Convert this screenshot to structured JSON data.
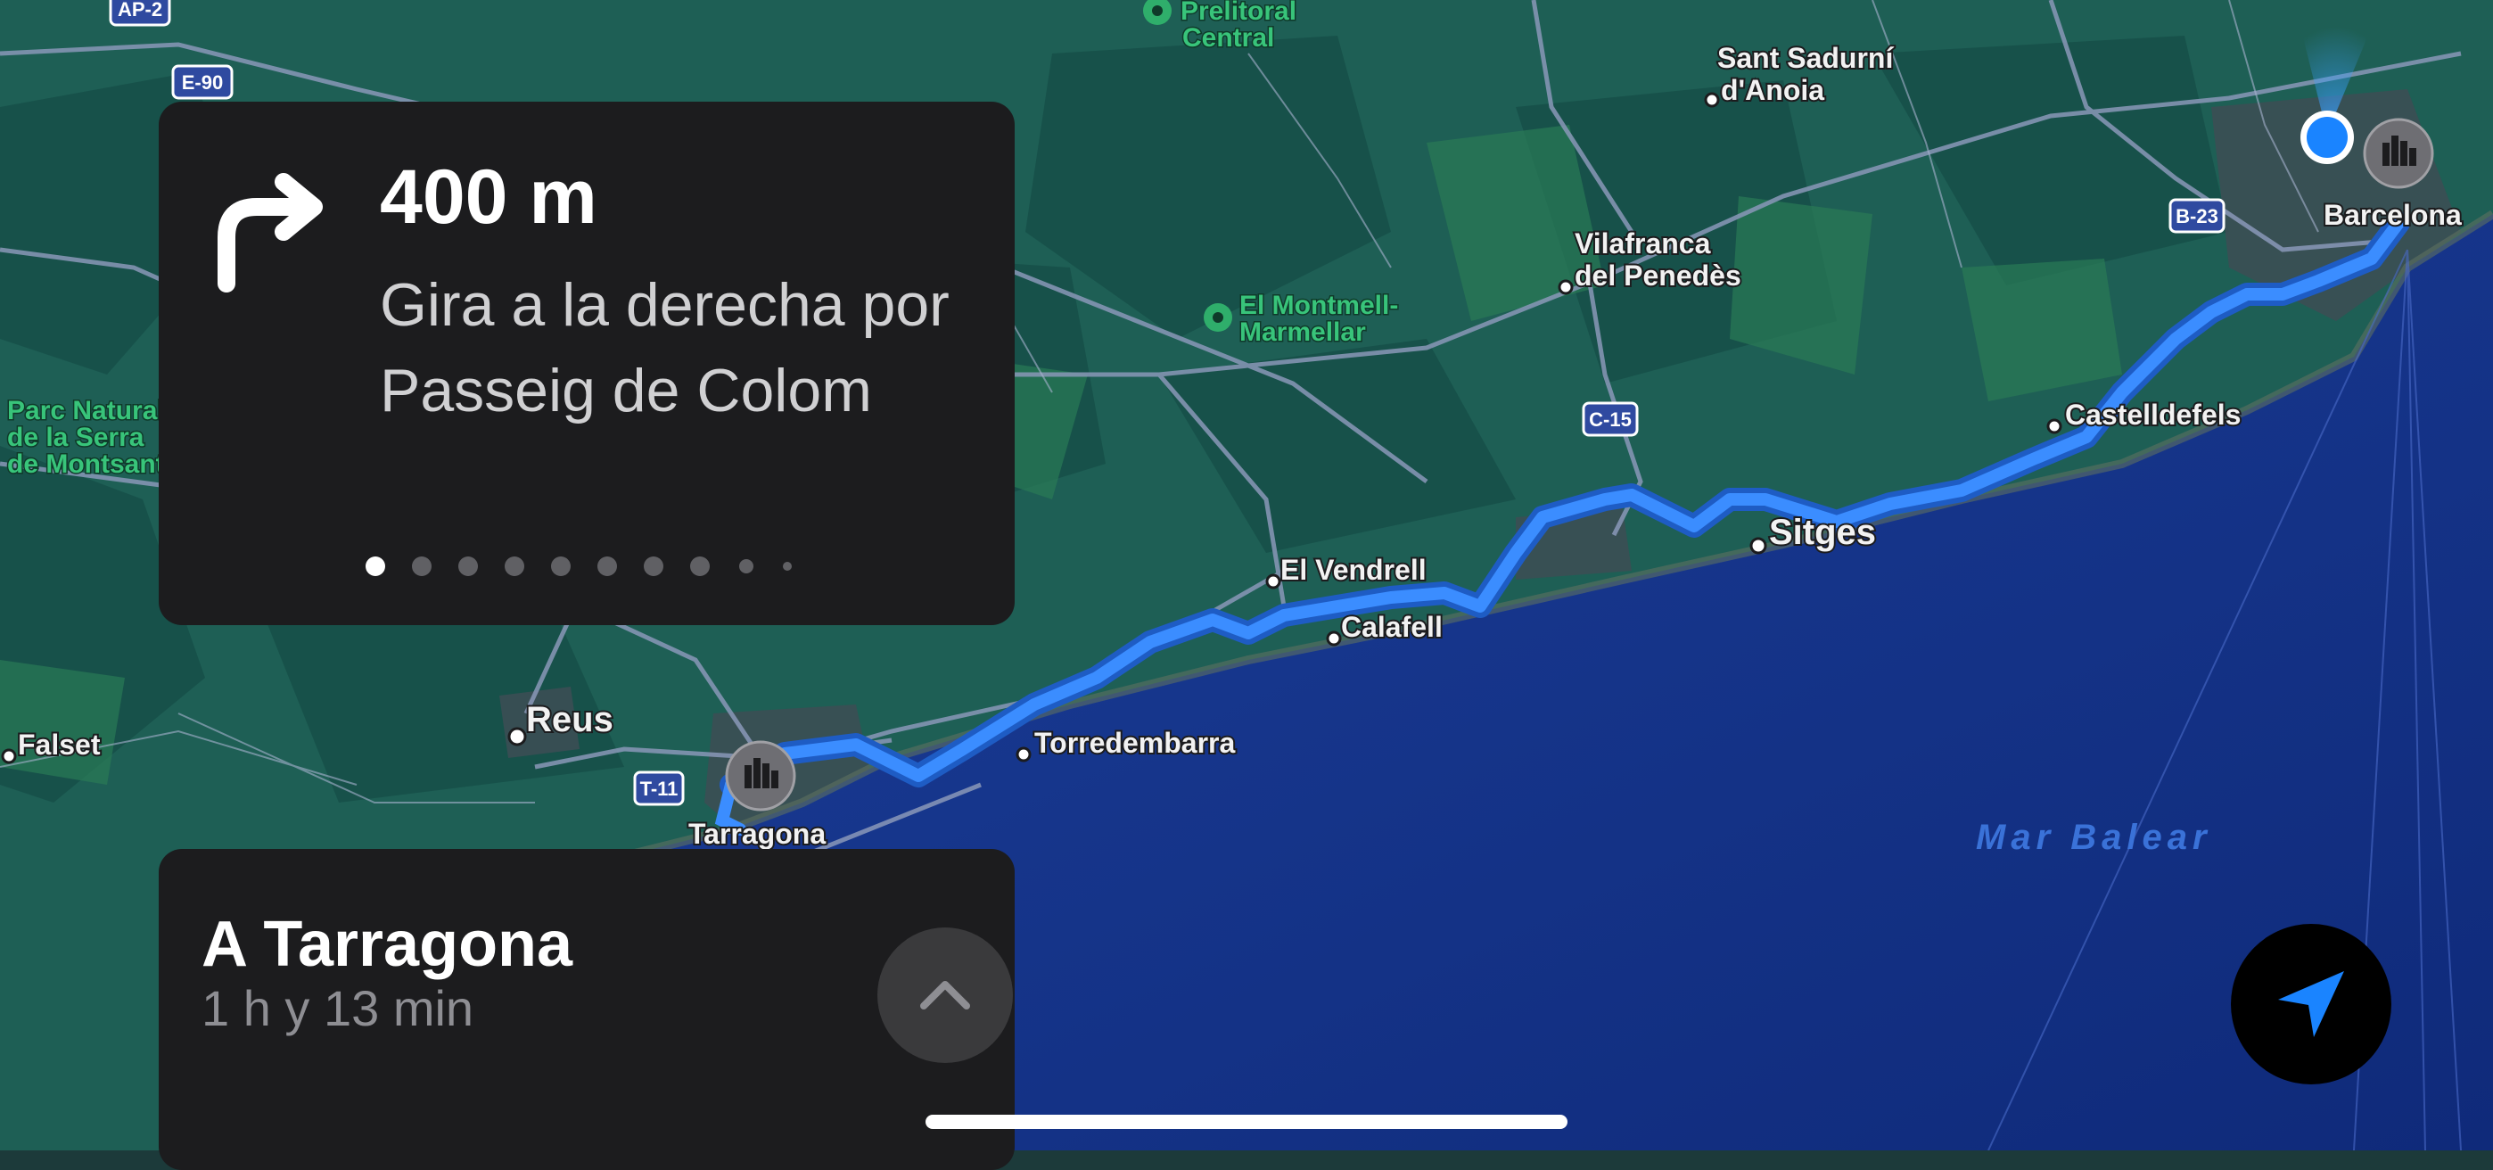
{
  "navigation": {
    "distance": "400 m",
    "instruction": "Gira a la derecha por Passeig de Colom",
    "turn_icon": "turn-right-icon",
    "step_indicator": {
      "total": 10,
      "current": 1
    }
  },
  "eta": {
    "destination": "A Tarragona",
    "duration": "1 h y 13 min",
    "expand_icon": "chevron-up-icon"
  },
  "locate_icon": "location-arrow-icon",
  "map": {
    "sea_name": "Mar Balear",
    "route_color": "#2f8bff",
    "cities": {
      "barcelona": "Barcelona",
      "tarragona": "Tarragona",
      "reus": "Reus",
      "sitges": "Sitges",
      "castelldefels": "Castelldefels",
      "calafell": "Calafell",
      "el_vendrell": "El Vendrell",
      "torredembarra": "Torredembarra",
      "vilafranca": [
        "Vilafranca",
        "del Penedès"
      ],
      "sant_sadurni": [
        "Sant Sadurní",
        "d'Anoia"
      ],
      "falset": "Falset"
    },
    "parks": {
      "prelitoral": [
        "Prelitoral",
        "Central"
      ],
      "montmell": [
        "El Montmell-",
        "Marmellar"
      ],
      "montsant": [
        "Parc Natural",
        "de la Serra",
        "de Montsant"
      ]
    },
    "road_shields": {
      "ap2": "AP-2",
      "e90": "E-90",
      "b23": "B-23",
      "c15": "C-15",
      "t11": "T-11"
    }
  }
}
